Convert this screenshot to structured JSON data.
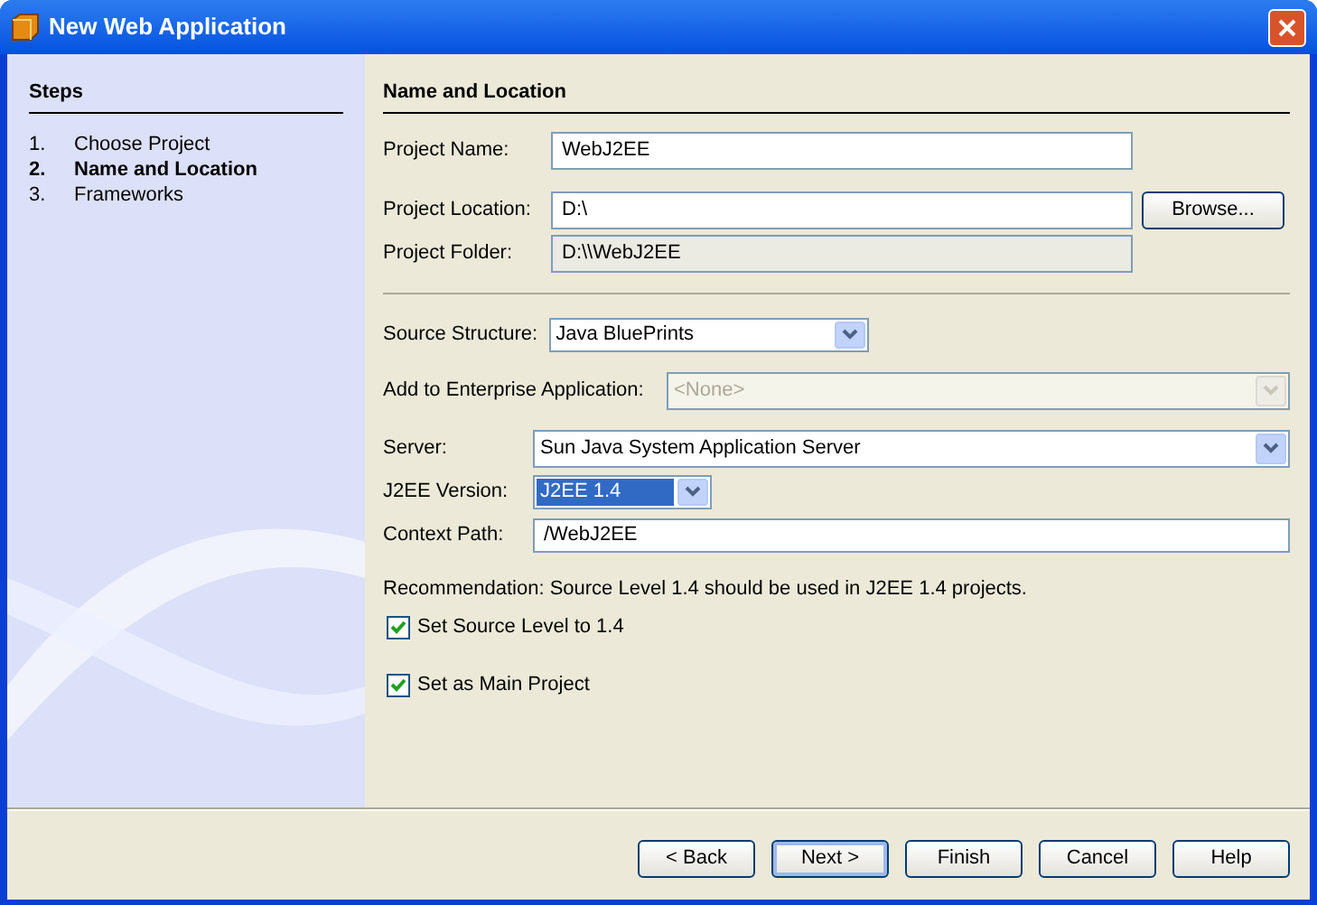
{
  "window": {
    "title": "New Web Application"
  },
  "steps": {
    "title": "Steps",
    "items": [
      {
        "number": "1.",
        "label": "Choose Project",
        "selected": false
      },
      {
        "number": "2.",
        "label": "Name and Location",
        "selected": true
      },
      {
        "number": "3.",
        "label": "Frameworks",
        "selected": false
      }
    ]
  },
  "section_title": "Name and Location",
  "location_fields": [
    {
      "kind": "text",
      "label": "Project Name:",
      "value": "WebJ2EE"
    },
    {
      "kind": "text",
      "label": "Project Location:",
      "value": "D:\\",
      "button": "Browse..."
    },
    {
      "kind": "readonly",
      "label": "Project Folder:",
      "value": "D:\\\\WebJ2EE"
    }
  ],
  "settings_fields": [
    {
      "kind": "combo",
      "label": "Source Structure:",
      "value": "Java BluePrints",
      "disabled": false,
      "highlighted": false
    },
    {
      "kind": "combo",
      "label": "Add to Enterprise Application:",
      "value": "<None>",
      "disabled": true,
      "highlighted": false
    },
    {
      "kind": "combo",
      "label": "Server:",
      "value": "Sun Java System Application Server",
      "disabled": false,
      "highlighted": false
    },
    {
      "kind": "combo",
      "label": "J2EE Version:",
      "value": "J2EE 1.4",
      "disabled": false,
      "highlighted": true
    },
    {
      "kind": "text",
      "label": "Context Path:",
      "value": "/WebJ2EE"
    }
  ],
  "recommendation": "Recommendation: Source Level 1.4 should be used in J2EE 1.4 projects.",
  "checkboxes": [
    {
      "label": "Set Source Level to 1.4",
      "checked": true
    },
    {
      "label": "Set as Main Project",
      "checked": true
    }
  ],
  "buttons": [
    {
      "label": "< Back",
      "default": false
    },
    {
      "label": "Next >",
      "default": true
    },
    {
      "label": "Finish",
      "default": false
    },
    {
      "label": "Cancel",
      "default": false
    },
    {
      "label": "Help",
      "default": false
    }
  ]
}
